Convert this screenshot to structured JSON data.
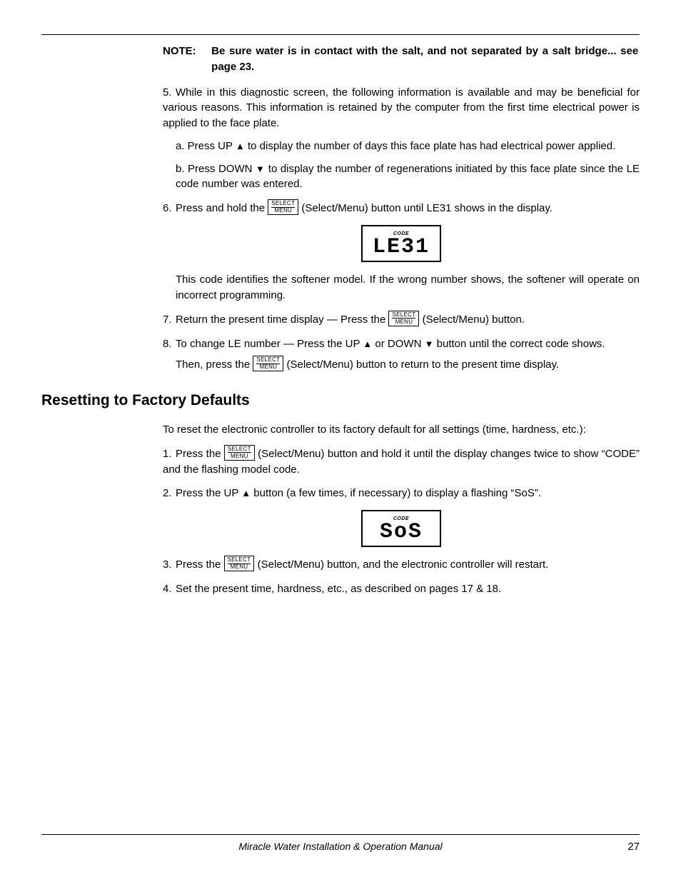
{
  "note": {
    "label": "NOTE:",
    "text": "Be sure water is in contact with the salt, and not separated by a salt bridge... see page 23."
  },
  "button": {
    "top": "SELECT",
    "bot": "MENU",
    "label": "(Select/Menu)"
  },
  "arrows": {
    "up": "▲",
    "down": "▼"
  },
  "items": {
    "5": {
      "num": "5.",
      "text": "While in this diagnostic screen, the following information is available and may be beneficial for various reasons. This information is retained by the computer from the first time electrical power is applied to the face plate.",
      "a_pre": "a. Press UP ",
      "a_post": " to display the number of days this face plate has had electrical power applied.",
      "b_pre": "b. Press DOWN ",
      "b_post": " to display the number of regenerations initiated by this face plate since the LE code number was entered."
    },
    "6": {
      "num": "6.",
      "pre": "Press and hold the  ",
      "post": "  (Select/Menu) button until LE31 shows in the display.",
      "lcd_code": "CODE",
      "lcd_val": "LE31",
      "after": "This code identifies the softener model. If the wrong number shows, the softener will operate on incorrect programming."
    },
    "7": {
      "num": "7.",
      "pre": "Return the present time display — Press the  ",
      "post": "  (Select/Menu) button."
    },
    "8": {
      "num": "8.",
      "pre": "To change LE number — Press the UP ",
      "mid": " or DOWN ",
      "post": " button until the correct code shows.",
      "then_pre": "Then, press the  ",
      "then_post": "  (Select/Menu) button to return to the present time display."
    }
  },
  "section2": {
    "heading": "Resetting to Factory Defaults",
    "intro": "To reset the electronic controller to its factory default for all settings (time, hardness, etc.):",
    "1": {
      "num": "1.",
      "pre": "Press the  ",
      "post": "  (Select/Menu) button and hold it until the display changes twice to show “CODE” and the flashing model code."
    },
    "2": {
      "num": "2.",
      "pre": "Press the UP ",
      "post": " button (a few times, if necessary) to display a flashing “SoS”.",
      "lcd_code": "CODE",
      "lcd_val": "SoS"
    },
    "3": {
      "num": "3.",
      "pre": "Press the  ",
      "post": "  (Select/Menu) button, and the electronic controller will restart."
    },
    "4": {
      "num": "4.",
      "text": "Set the present time, hardness, etc., as described on pages 17 & 18."
    }
  },
  "footer": {
    "title": "Miracle Water Installation & Operation Manual",
    "page": "27"
  }
}
